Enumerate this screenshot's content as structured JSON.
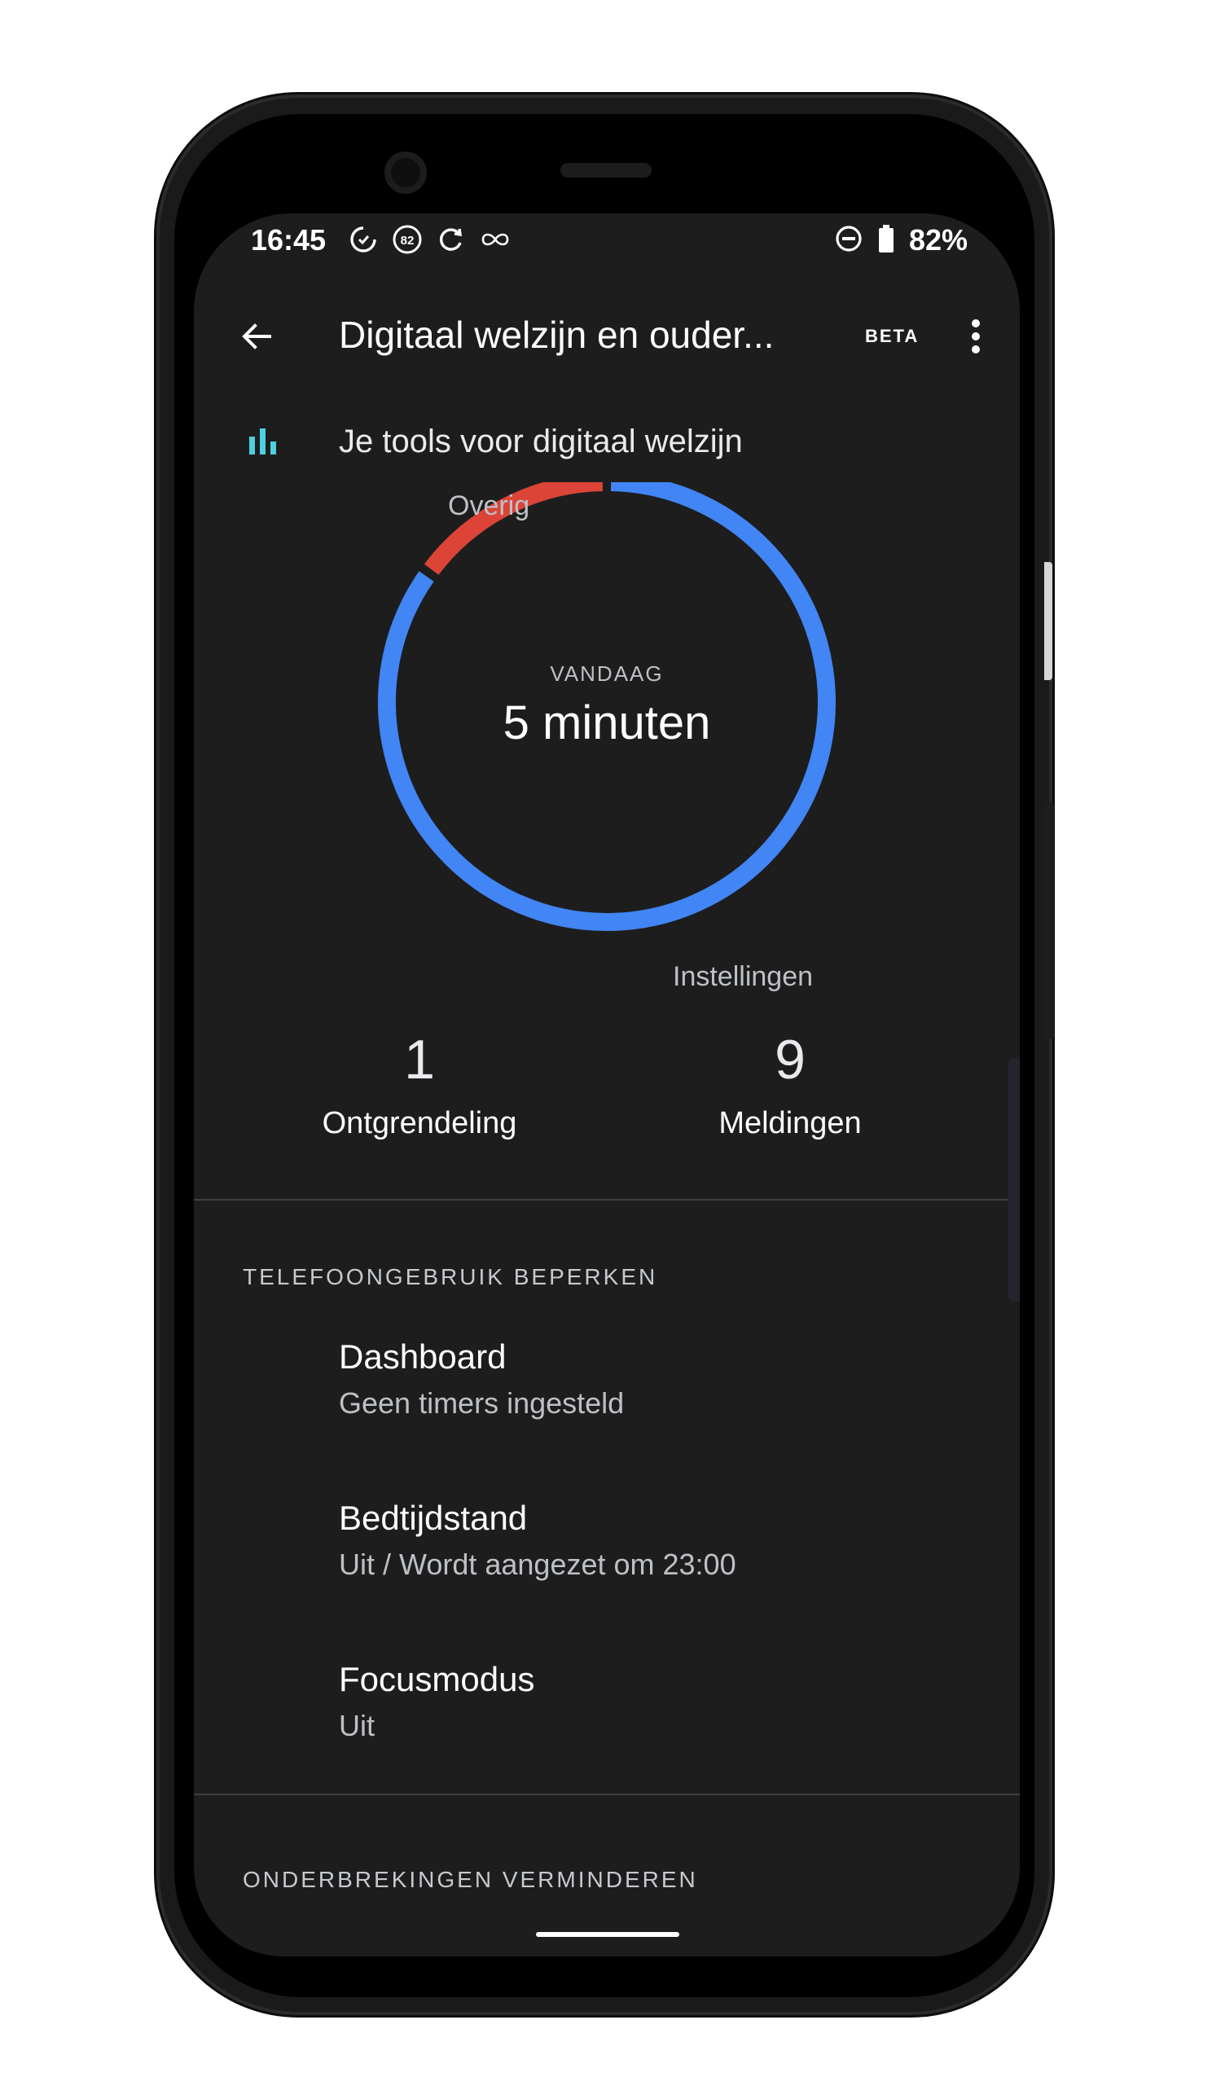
{
  "status_bar": {
    "time": "16:45",
    "notification_badge": "82",
    "battery_percent": "82%"
  },
  "toolbar": {
    "title": "Digitaal welzijn en ouder...",
    "badge": "BETA"
  },
  "tools_section": {
    "title": "Je tools voor digitaal welzijn"
  },
  "usage_chart": {
    "segment_labels": {
      "other": "Overig",
      "settings": "Instellingen"
    },
    "center_caption": "VANDAAG",
    "center_value": "5 minuten"
  },
  "chart_data": {
    "type": "pie",
    "categories": [
      "Instellingen",
      "Overig"
    ],
    "values": [
      0.85,
      0.15
    ],
    "colors": [
      "#4285f4",
      "#db4437"
    ]
  },
  "stats": {
    "unlocks": {
      "value": "1",
      "label": "Ontgrendeling"
    },
    "notifications": {
      "value": "9",
      "label": "Meldingen"
    }
  },
  "limit_section": {
    "header": "TELEFOONGEBRUIK BEPERKEN",
    "items": [
      {
        "title": "Dashboard",
        "subtitle": "Geen timers ingesteld"
      },
      {
        "title": "Bedtijdstand",
        "subtitle": "Uit / Wordt aangezet om 23:00"
      },
      {
        "title": "Focusmodus",
        "subtitle": "Uit"
      }
    ]
  },
  "interruptions_section": {
    "header": "ONDERBREKINGEN VERMINDEREN"
  },
  "icons": {
    "back": "arrow-left-icon",
    "more": "more-vert-icon",
    "tools": "bar-chart-icon"
  },
  "colors": {
    "screen_bg": "#1d1d1d",
    "accent_blue": "#4285f4",
    "accent_red": "#db4437",
    "tools_icon": "#4dd0e1"
  }
}
